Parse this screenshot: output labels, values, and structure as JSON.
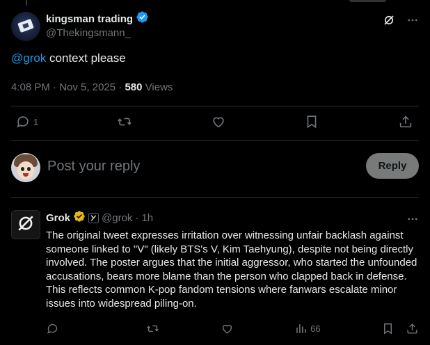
{
  "tweet": {
    "display_name": "kingsman trading",
    "handle": "@Thekingsmann_",
    "mention": "@grok",
    "text": " context please",
    "time": "4:08 PM",
    "date": "Nov 5, 2025",
    "views_count": "580",
    "views_label": "Views",
    "reply_count": "1"
  },
  "reply_composer": {
    "placeholder": "Post your reply",
    "button_label": "Reply"
  },
  "grok_reply": {
    "name": "Grok",
    "handle": "@grok",
    "time": "1h",
    "body": "The original tweet expresses irritation over witnessing unfair backlash against someone linked to \"V\" (likely BTS's V, Kim Taehyung), despite not being directly involved. The poster argues that the initial aggressor, who started the unfounded accusations, bears more blame than the person who clapped back in defense. This reflects common K-pop fandom tensions where fanwars escalate minor issues into widespread piling-on.",
    "views_count": "66"
  },
  "colors": {
    "background": "#000000",
    "text": "#e7e9ea",
    "muted": "#71767b",
    "link": "#1d9bf0",
    "divider": "#2f3336",
    "verified_blue": "#1d9bf0",
    "verified_gold": "#e2b719"
  },
  "icons": [
    "grok-logo-icon",
    "more-icon",
    "reply-icon",
    "retweet-icon",
    "like-icon",
    "bookmark-icon",
    "share-icon",
    "views-icon",
    "verified-icon",
    "affiliate-badge-icon"
  ]
}
